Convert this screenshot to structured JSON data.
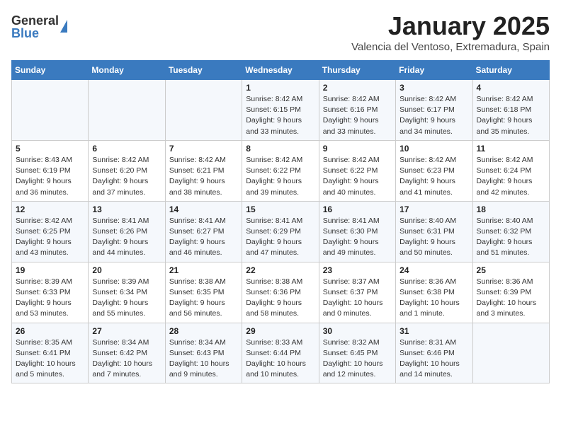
{
  "header": {
    "logo": {
      "general": "General",
      "blue": "Blue"
    },
    "title": "January 2025",
    "location": "Valencia del Ventoso, Extremadura, Spain"
  },
  "weekdays": [
    "Sunday",
    "Monday",
    "Tuesday",
    "Wednesday",
    "Thursday",
    "Friday",
    "Saturday"
  ],
  "weeks": [
    [
      {
        "day": "",
        "info": ""
      },
      {
        "day": "",
        "info": ""
      },
      {
        "day": "",
        "info": ""
      },
      {
        "day": "1",
        "info": "Sunrise: 8:42 AM\nSunset: 6:15 PM\nDaylight: 9 hours\nand 33 minutes."
      },
      {
        "day": "2",
        "info": "Sunrise: 8:42 AM\nSunset: 6:16 PM\nDaylight: 9 hours\nand 33 minutes."
      },
      {
        "day": "3",
        "info": "Sunrise: 8:42 AM\nSunset: 6:17 PM\nDaylight: 9 hours\nand 34 minutes."
      },
      {
        "day": "4",
        "info": "Sunrise: 8:42 AM\nSunset: 6:18 PM\nDaylight: 9 hours\nand 35 minutes."
      }
    ],
    [
      {
        "day": "5",
        "info": "Sunrise: 8:43 AM\nSunset: 6:19 PM\nDaylight: 9 hours\nand 36 minutes."
      },
      {
        "day": "6",
        "info": "Sunrise: 8:42 AM\nSunset: 6:20 PM\nDaylight: 9 hours\nand 37 minutes."
      },
      {
        "day": "7",
        "info": "Sunrise: 8:42 AM\nSunset: 6:21 PM\nDaylight: 9 hours\nand 38 minutes."
      },
      {
        "day": "8",
        "info": "Sunrise: 8:42 AM\nSunset: 6:22 PM\nDaylight: 9 hours\nand 39 minutes."
      },
      {
        "day": "9",
        "info": "Sunrise: 8:42 AM\nSunset: 6:22 PM\nDaylight: 9 hours\nand 40 minutes."
      },
      {
        "day": "10",
        "info": "Sunrise: 8:42 AM\nSunset: 6:23 PM\nDaylight: 9 hours\nand 41 minutes."
      },
      {
        "day": "11",
        "info": "Sunrise: 8:42 AM\nSunset: 6:24 PM\nDaylight: 9 hours\nand 42 minutes."
      }
    ],
    [
      {
        "day": "12",
        "info": "Sunrise: 8:42 AM\nSunset: 6:25 PM\nDaylight: 9 hours\nand 43 minutes."
      },
      {
        "day": "13",
        "info": "Sunrise: 8:41 AM\nSunset: 6:26 PM\nDaylight: 9 hours\nand 44 minutes."
      },
      {
        "day": "14",
        "info": "Sunrise: 8:41 AM\nSunset: 6:27 PM\nDaylight: 9 hours\nand 46 minutes."
      },
      {
        "day": "15",
        "info": "Sunrise: 8:41 AM\nSunset: 6:29 PM\nDaylight: 9 hours\nand 47 minutes."
      },
      {
        "day": "16",
        "info": "Sunrise: 8:41 AM\nSunset: 6:30 PM\nDaylight: 9 hours\nand 49 minutes."
      },
      {
        "day": "17",
        "info": "Sunrise: 8:40 AM\nSunset: 6:31 PM\nDaylight: 9 hours\nand 50 minutes."
      },
      {
        "day": "18",
        "info": "Sunrise: 8:40 AM\nSunset: 6:32 PM\nDaylight: 9 hours\nand 51 minutes."
      }
    ],
    [
      {
        "day": "19",
        "info": "Sunrise: 8:39 AM\nSunset: 6:33 PM\nDaylight: 9 hours\nand 53 minutes."
      },
      {
        "day": "20",
        "info": "Sunrise: 8:39 AM\nSunset: 6:34 PM\nDaylight: 9 hours\nand 55 minutes."
      },
      {
        "day": "21",
        "info": "Sunrise: 8:38 AM\nSunset: 6:35 PM\nDaylight: 9 hours\nand 56 minutes."
      },
      {
        "day": "22",
        "info": "Sunrise: 8:38 AM\nSunset: 6:36 PM\nDaylight: 9 hours\nand 58 minutes."
      },
      {
        "day": "23",
        "info": "Sunrise: 8:37 AM\nSunset: 6:37 PM\nDaylight: 10 hours\nand 0 minutes."
      },
      {
        "day": "24",
        "info": "Sunrise: 8:36 AM\nSunset: 6:38 PM\nDaylight: 10 hours\nand 1 minute."
      },
      {
        "day": "25",
        "info": "Sunrise: 8:36 AM\nSunset: 6:39 PM\nDaylight: 10 hours\nand 3 minutes."
      }
    ],
    [
      {
        "day": "26",
        "info": "Sunrise: 8:35 AM\nSunset: 6:41 PM\nDaylight: 10 hours\nand 5 minutes."
      },
      {
        "day": "27",
        "info": "Sunrise: 8:34 AM\nSunset: 6:42 PM\nDaylight: 10 hours\nand 7 minutes."
      },
      {
        "day": "28",
        "info": "Sunrise: 8:34 AM\nSunset: 6:43 PM\nDaylight: 10 hours\nand 9 minutes."
      },
      {
        "day": "29",
        "info": "Sunrise: 8:33 AM\nSunset: 6:44 PM\nDaylight: 10 hours\nand 10 minutes."
      },
      {
        "day": "30",
        "info": "Sunrise: 8:32 AM\nSunset: 6:45 PM\nDaylight: 10 hours\nand 12 minutes."
      },
      {
        "day": "31",
        "info": "Sunrise: 8:31 AM\nSunset: 6:46 PM\nDaylight: 10 hours\nand 14 minutes."
      },
      {
        "day": "",
        "info": ""
      }
    ]
  ]
}
